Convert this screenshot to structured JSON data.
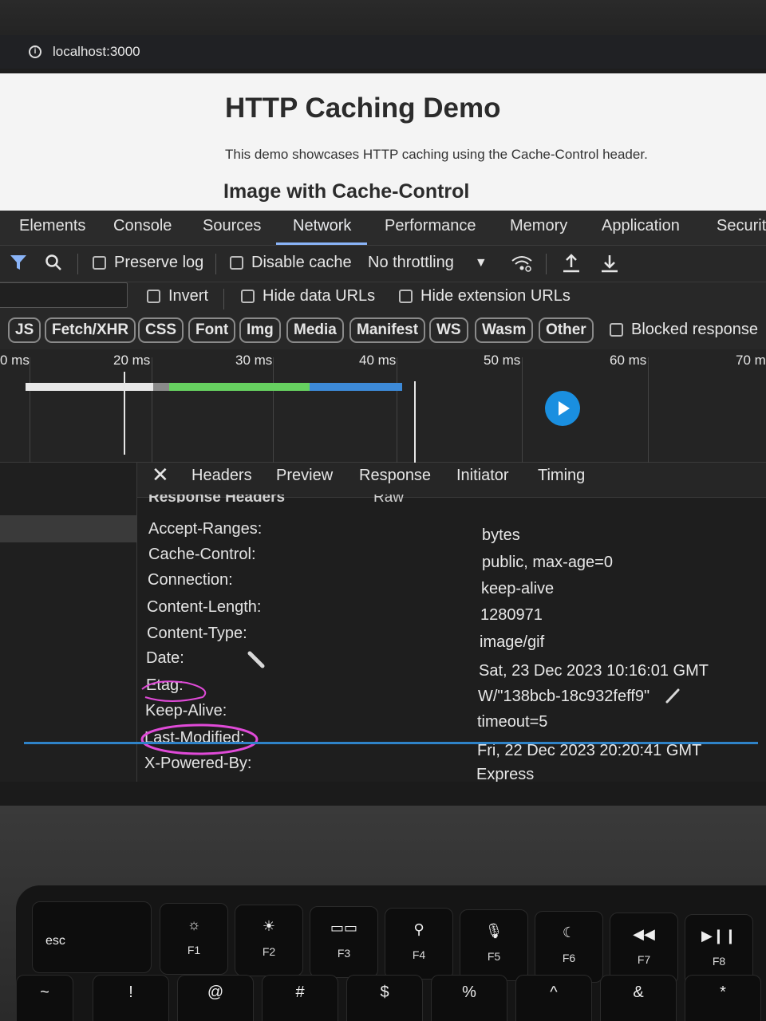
{
  "browser": {
    "url": "localhost:3000"
  },
  "page": {
    "title": "HTTP Caching Demo",
    "description": "This demo showcases HTTP caching using the Cache-Control header.",
    "section_title": "Image with Cache-Control"
  },
  "devtools": {
    "tabs": [
      "Elements",
      "Console",
      "Sources",
      "Network",
      "Performance",
      "Memory",
      "Application",
      "Securit"
    ],
    "active_tab": "Network",
    "toolbar": {
      "preserve_log": "Preserve log",
      "disable_cache": "Disable cache",
      "throttling": "No throttling"
    },
    "filters": {
      "invert": "Invert",
      "hide_data_urls": "Hide data URLs",
      "hide_extension_urls": "Hide extension URLs"
    },
    "types": [
      "JS",
      "Fetch/XHR",
      "CSS",
      "Font",
      "Img",
      "Media",
      "Manifest",
      "WS",
      "Wasm",
      "Other"
    ],
    "blocked_responses": "Blocked response",
    "timeline_ticks": [
      "0 ms",
      "20 ms",
      "30 ms",
      "40 ms",
      "50 ms",
      "60 ms",
      "70 m"
    ],
    "detail_tabs": [
      "Headers",
      "Preview",
      "Response",
      "Initiator",
      "Timing"
    ],
    "section_header": "Response Headers",
    "raw_label": "Raw",
    "response_headers": [
      {
        "name": "Accept-Ranges:",
        "value": "bytes"
      },
      {
        "name": "Cache-Control:",
        "value": "public, max-age=0"
      },
      {
        "name": "Connection:",
        "value": "keep-alive"
      },
      {
        "name": "Content-Length:",
        "value": "1280971"
      },
      {
        "name": "Content-Type:",
        "value": "image/gif"
      },
      {
        "name": "Date:",
        "value": "Sat, 23 Dec 2023 10:16:01 GMT"
      },
      {
        "name": "Etag:",
        "value": "W/\"138bcb-18c932feff9\""
      },
      {
        "name": "Keep-Alive:",
        "value": "timeout=5"
      },
      {
        "name": "Last-Modified:",
        "value": "Fri, 22 Dec 2023 20:20:41 GMT"
      },
      {
        "name": "X-Powered-By:",
        "value": "Express"
      }
    ],
    "colors": {
      "accent": "#8ab4f8",
      "annotation": "#e04ad8",
      "play_button": "#1a8fe0"
    }
  },
  "keyboard": {
    "function_keys": [
      {
        "icon": "brightness-down-icon",
        "label": "F1"
      },
      {
        "icon": "brightness-up-icon",
        "label": "F2"
      },
      {
        "icon": "mission-control-icon",
        "label": "F3"
      },
      {
        "icon": "search-icon",
        "label": "F4"
      },
      {
        "icon": "microphone-icon",
        "label": "F5"
      },
      {
        "icon": "moon-icon",
        "label": "F6"
      },
      {
        "icon": "rewind-icon",
        "label": "F7"
      },
      {
        "icon": "play-pause-icon",
        "label": "F8"
      }
    ],
    "esc": "esc",
    "symbols": [
      "~",
      "!",
      "@",
      "#",
      "$",
      "%",
      "^",
      "&",
      "*"
    ]
  }
}
